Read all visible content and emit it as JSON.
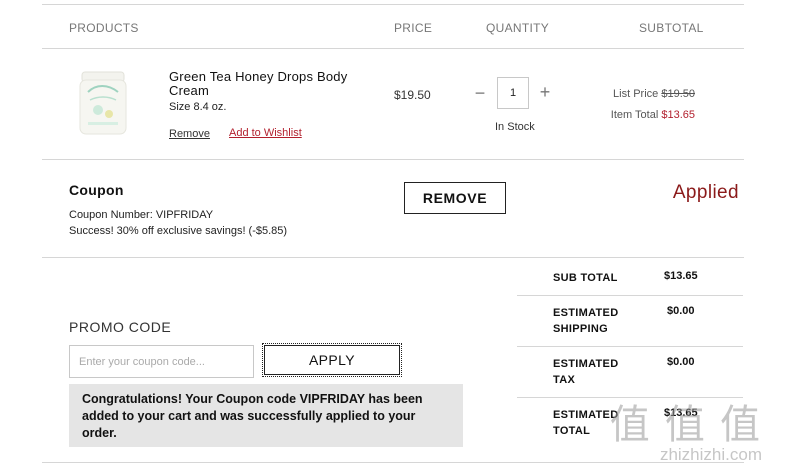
{
  "columns": {
    "products": "PRODUCTS",
    "price": "PRICE",
    "quantity": "QUANTITY",
    "subtotal": "SUBTOTAL"
  },
  "product": {
    "name": "Green Tea Honey Drops Body Cream",
    "size": "Size 8.4 oz.",
    "remove_label": "Remove",
    "wishlist_label": "Add to Wishlist",
    "price": "$19.50",
    "quantity": "1",
    "stock_status": "In Stock",
    "list_price_label": "List Price",
    "list_price": "$19.50",
    "item_total_label": "Item Total",
    "item_total": "$13.65"
  },
  "coupon": {
    "title": "Coupon",
    "number_text": "Coupon Number: VIPFRIDAY",
    "success_text": "Success! 30% off exclusive savings! (-$5.85)",
    "remove_button": "REMOVE",
    "status": "Applied"
  },
  "promo": {
    "label": "PROMO CODE",
    "placeholder": "Enter your coupon code...",
    "apply_button": "APPLY",
    "message": "Congratulations! Your Coupon code VIPFRIDAY has been added to your cart and was successfully applied to your order."
  },
  "summary": {
    "sub_total_label": "SUB TOTAL",
    "sub_total": "$13.65",
    "shipping_label": "ESTIMATED SHIPPING",
    "shipping": "$0.00",
    "tax_label": "ESTIMATED TAX",
    "tax": "$0.00",
    "total_label": "ESTIMATED TOTAL",
    "total": "$13.65"
  },
  "colors": {
    "accent_red": "#b21f2d",
    "applied_red": "#8b1a1a",
    "message_bg": "#e5e5e5"
  },
  "icons": {
    "minus": "minus-icon",
    "plus": "plus-icon"
  },
  "watermark": {
    "text": "值 值 值",
    "sub": "zhizhizhi.com"
  }
}
